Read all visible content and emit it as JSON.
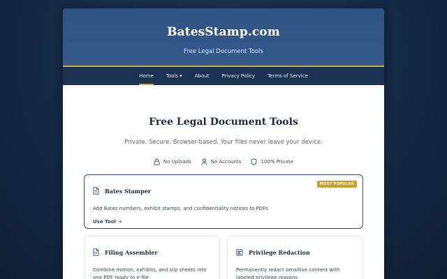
{
  "site": {
    "title": "BatesStamp.com",
    "subtitle": "Free Legal Document Tools"
  },
  "nav": {
    "items": [
      {
        "label": "Home",
        "active": true
      },
      {
        "label": "Tools ▾",
        "active": false
      },
      {
        "label": "About",
        "active": false
      },
      {
        "label": "Privacy Policy",
        "active": false
      },
      {
        "label": "Terms of Service",
        "active": false
      }
    ]
  },
  "main": {
    "heading": "Free Legal Document Tools",
    "tagline": "Private. Secure. Browser-based. Your files never leave your device.",
    "features": [
      {
        "icon": "lock-icon",
        "label": "No Uploads"
      },
      {
        "icon": "user-icon",
        "label": "No Accounts"
      },
      {
        "icon": "shield-icon",
        "label": "100% Private"
      }
    ]
  },
  "tools": [
    {
      "title": "Bates Stamper",
      "description": "Add Bates numbers, exhibit stamps, and confidentiality notices to PDFs",
      "link": "Use Tool →",
      "badge": "MOST POPULAR",
      "icon": "document-icon"
    },
    {
      "title": "Filing Assembler",
      "description": "Combine motion, exhibits, and slip sheets into one PDF ready to e-file",
      "icon": "document-icon"
    },
    {
      "title": "Privilege Redaction",
      "description": "Permanently redact sensitive content with labeled privilege reasons",
      "icon": "redaction-icon"
    }
  ],
  "colors": {
    "hero": "#2f5383",
    "nav": "#1c3252",
    "accent_gold": "#c9a84a",
    "navy_text": "#1d2b40"
  }
}
